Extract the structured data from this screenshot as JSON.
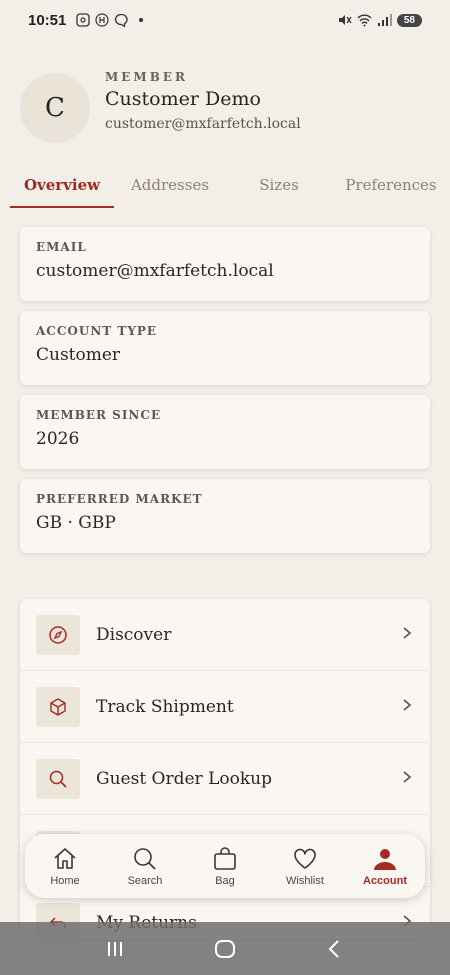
{
  "status_bar": {
    "time": "10:51",
    "battery": "58"
  },
  "profile": {
    "initial": "C",
    "label": "MEMBER",
    "name": "Customer Demo",
    "email": "customer@mxfarfetch.local"
  },
  "tabs": [
    {
      "label": "Overview",
      "active": true
    },
    {
      "label": "Addresses",
      "active": false
    },
    {
      "label": "Sizes",
      "active": false
    },
    {
      "label": "Preferences",
      "active": false
    }
  ],
  "info_cards": [
    {
      "label": "EMAIL",
      "value": "customer@mxfarfetch.local"
    },
    {
      "label": "ACCOUNT TYPE",
      "value": "Customer"
    },
    {
      "label": "MEMBER SINCE",
      "value": "2026"
    },
    {
      "label": "PREFERRED MARKET",
      "value": "GB · GBP"
    }
  ],
  "menu": [
    {
      "label": "Discover",
      "icon": "compass-icon"
    },
    {
      "label": "Track Shipment",
      "icon": "box-icon"
    },
    {
      "label": "Guest Order Lookup",
      "icon": "search-icon"
    },
    {
      "label": "",
      "icon": "blank-icon"
    },
    {
      "label": "My Returns",
      "icon": "return-arrow-icon"
    }
  ],
  "bottom_nav": [
    {
      "label": "Home",
      "icon": "home-icon"
    },
    {
      "label": "Search",
      "icon": "search-icon"
    },
    {
      "label": "Bag",
      "icon": "bag-icon"
    },
    {
      "label": "Wishlist",
      "icon": "heart-icon"
    },
    {
      "label": "Account",
      "icon": "person-icon",
      "active": true
    }
  ],
  "colors": {
    "accent": "#a32d20",
    "background": "#f3efe8",
    "card": "#faf7f2"
  }
}
